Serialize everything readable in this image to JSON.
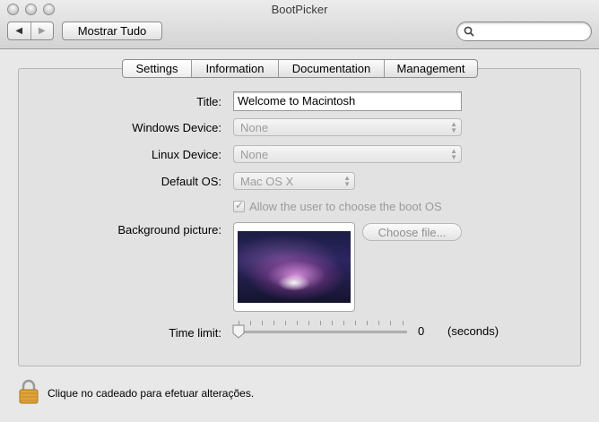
{
  "window": {
    "title": "BootPicker"
  },
  "toolbar": {
    "back_icon": "back-arrow-icon",
    "forward_icon": "forward-arrow-icon",
    "show_all_label": "Mostrar Tudo",
    "search_placeholder": ""
  },
  "tabs": [
    {
      "label": "Settings",
      "selected": true
    },
    {
      "label": "Information",
      "selected": false
    },
    {
      "label": "Documentation",
      "selected": false
    },
    {
      "label": "Management",
      "selected": false
    }
  ],
  "form": {
    "title_label": "Title:",
    "title_value": "Welcome to Macintosh",
    "windows_label": "Windows Device:",
    "windows_value": "None",
    "linux_label": "Linux Device:",
    "linux_value": "None",
    "default_os_label": "Default OS:",
    "default_os_value": "Mac OS X",
    "allow_choose_label": "Allow the user to choose the boot OS",
    "allow_choose_checked": true,
    "background_label": "Background picture:",
    "choose_file_label": "Choose file...",
    "time_limit_label": "Time limit:",
    "time_limit_value": "0",
    "time_limit_unit": "(seconds)"
  },
  "footer": {
    "lock_text": "Clique no cadeado para efetuar alterações."
  },
  "colors": {
    "window_bg": "#e8e8e8",
    "panel_bg": "#e2e2e2",
    "disabled_text": "#9c9c9c"
  }
}
